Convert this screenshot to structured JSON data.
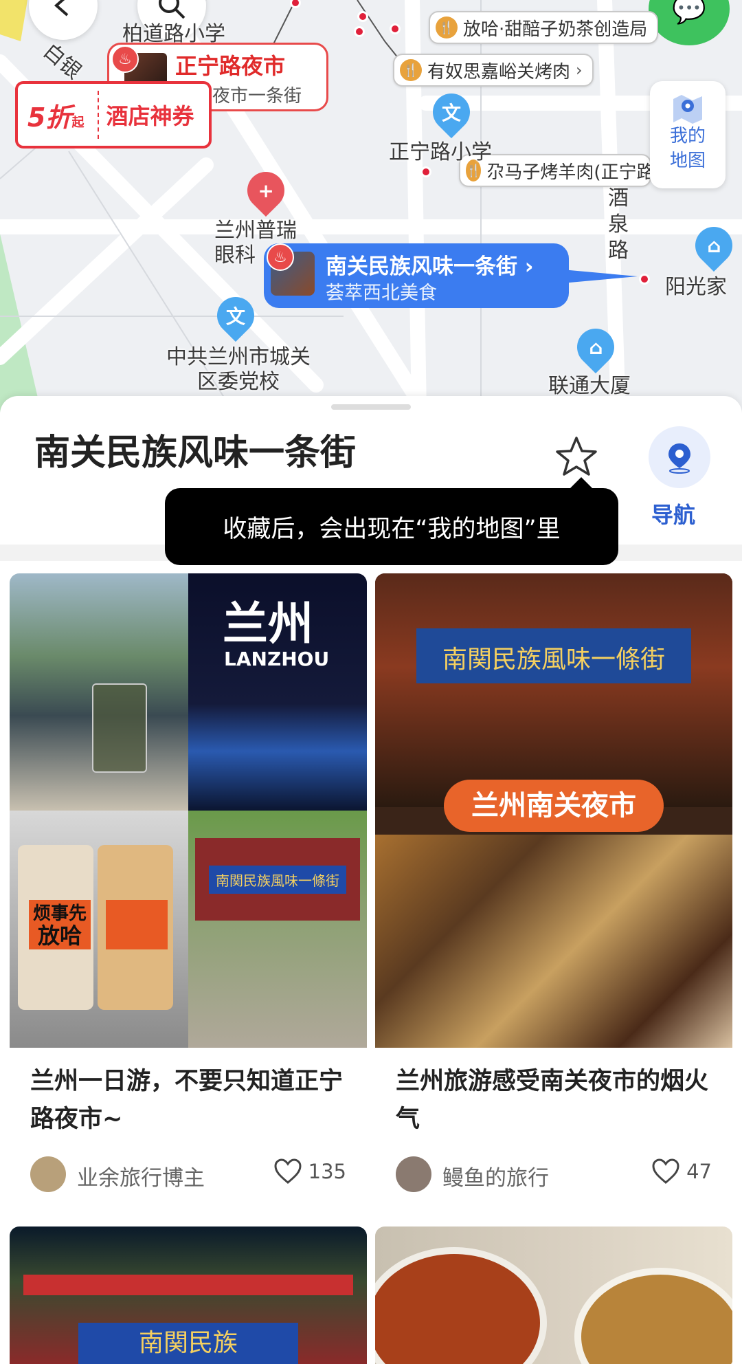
{
  "map": {
    "labels": {
      "school_top": "柏道路小学",
      "school_mid": "正宁路小学",
      "hospital": "兰州普瑞眼科",
      "gov": "中共兰州市城关区委党校",
      "road": "酒泉路",
      "unicom": "联通大厦",
      "sunshine": "阳光家",
      "road_left": "白银"
    },
    "pois": {
      "milk_tea": "放哈·甜醅子奶茶创造局",
      "bbq": "有奴思嘉峪关烤肉",
      "lamb": "尕马子烤羊肉(正宁路)"
    },
    "night_market": {
      "title": "正宁路夜市",
      "sub": "夜市一条街"
    },
    "coupon": {
      "pct": "5折",
      "qi": "起",
      "text": "酒店神券"
    },
    "selected": {
      "title": "南关民族风味一条街",
      "sub": "荟萃西北美食"
    },
    "my_map": "我的地图"
  },
  "sheet": {
    "title": "南关民族风味一条街",
    "nav_label": "导航",
    "tooltip": "收藏后，会出现在“我的地图”里"
  },
  "feed": [
    {
      "title": "兰州一日游，不要只知道正宁路夜市~",
      "author": "业余旅行博主",
      "likes": "135",
      "img_texts": [
        "兰州",
        "LANZHOU",
        "烦事先",
        "放哈",
        "南関民族風味一條街"
      ]
    },
    {
      "title": "兰州旅游感受南关夜市的烟火气",
      "author": "鳗鱼的旅行",
      "likes": "47",
      "img_texts": [
        "南関民族風味一條街",
        "兰州南关夜市"
      ]
    },
    {
      "img_texts": [
        "南関民族"
      ]
    },
    {
      "img_texts": []
    }
  ],
  "colors": {
    "accent": "#3b7cf0",
    "red": "#e8323c",
    "wechat": "#3ec25e"
  }
}
